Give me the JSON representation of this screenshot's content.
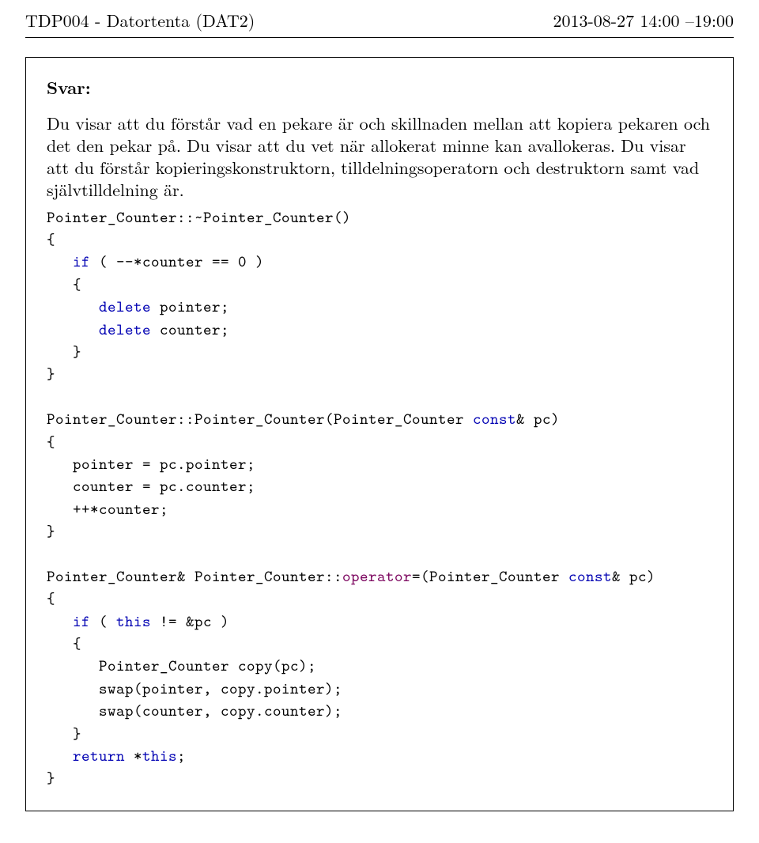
{
  "header": {
    "left": "TDP004 - Datortenta (DAT2)",
    "right": "2013-08-27   14:00 –19:00"
  },
  "answer_label": "Svar:",
  "body_text": "Du visar att du förstår vad en pekare är och skillnaden mellan att kopiera pekaren och det den pekar på. Du visar att du vet när allokerat minne kan avallokeras. Du visar att du förstår kopieringskonstruktorn, tilldelningsoperatorn och destruktorn samt vad självtilldelning är.",
  "code": {
    "line01_a": "Pointer_Counter::~Pointer_Counter()",
    "line02": "{",
    "line03_a": "   ",
    "line03_b": "if",
    "line03_c": " ( --*counter == 0 )",
    "line04": "   {",
    "line05_a": "      ",
    "line05_b": "delete",
    "line05_c": " pointer;",
    "line06_a": "      ",
    "line06_b": "delete",
    "line06_c": " counter;",
    "line07": "   }",
    "line08": "}",
    "line09": "",
    "line10_a": "Pointer_Counter::Pointer_Counter(Pointer_Counter ",
    "line10_b": "const",
    "line10_c": "& pc)",
    "line11": "{",
    "line12": "   pointer = pc.pointer;",
    "line13": "   counter = pc.counter;",
    "line14": "   ++*counter;",
    "line15": "}",
    "line16": "",
    "line17_a": "Pointer_Counter& Pointer_Counter::",
    "line17_b": "operator",
    "line17_c": "=(Pointer_Counter ",
    "line17_d": "const",
    "line17_e": "& pc)",
    "line18": "{",
    "line19_a": "   ",
    "line19_b": "if",
    "line19_c": " ( ",
    "line19_d": "this",
    "line19_e": " != &pc )",
    "line20": "   {",
    "line21": "      Pointer_Counter copy(pc);",
    "line22": "      swap(pointer, copy.pointer);",
    "line23": "      swap(counter, copy.counter);",
    "line24": "   }",
    "line25_a": "   ",
    "line25_b": "return",
    "line25_c": " *",
    "line25_d": "this",
    "line25_e": ";",
    "line26": "}"
  }
}
